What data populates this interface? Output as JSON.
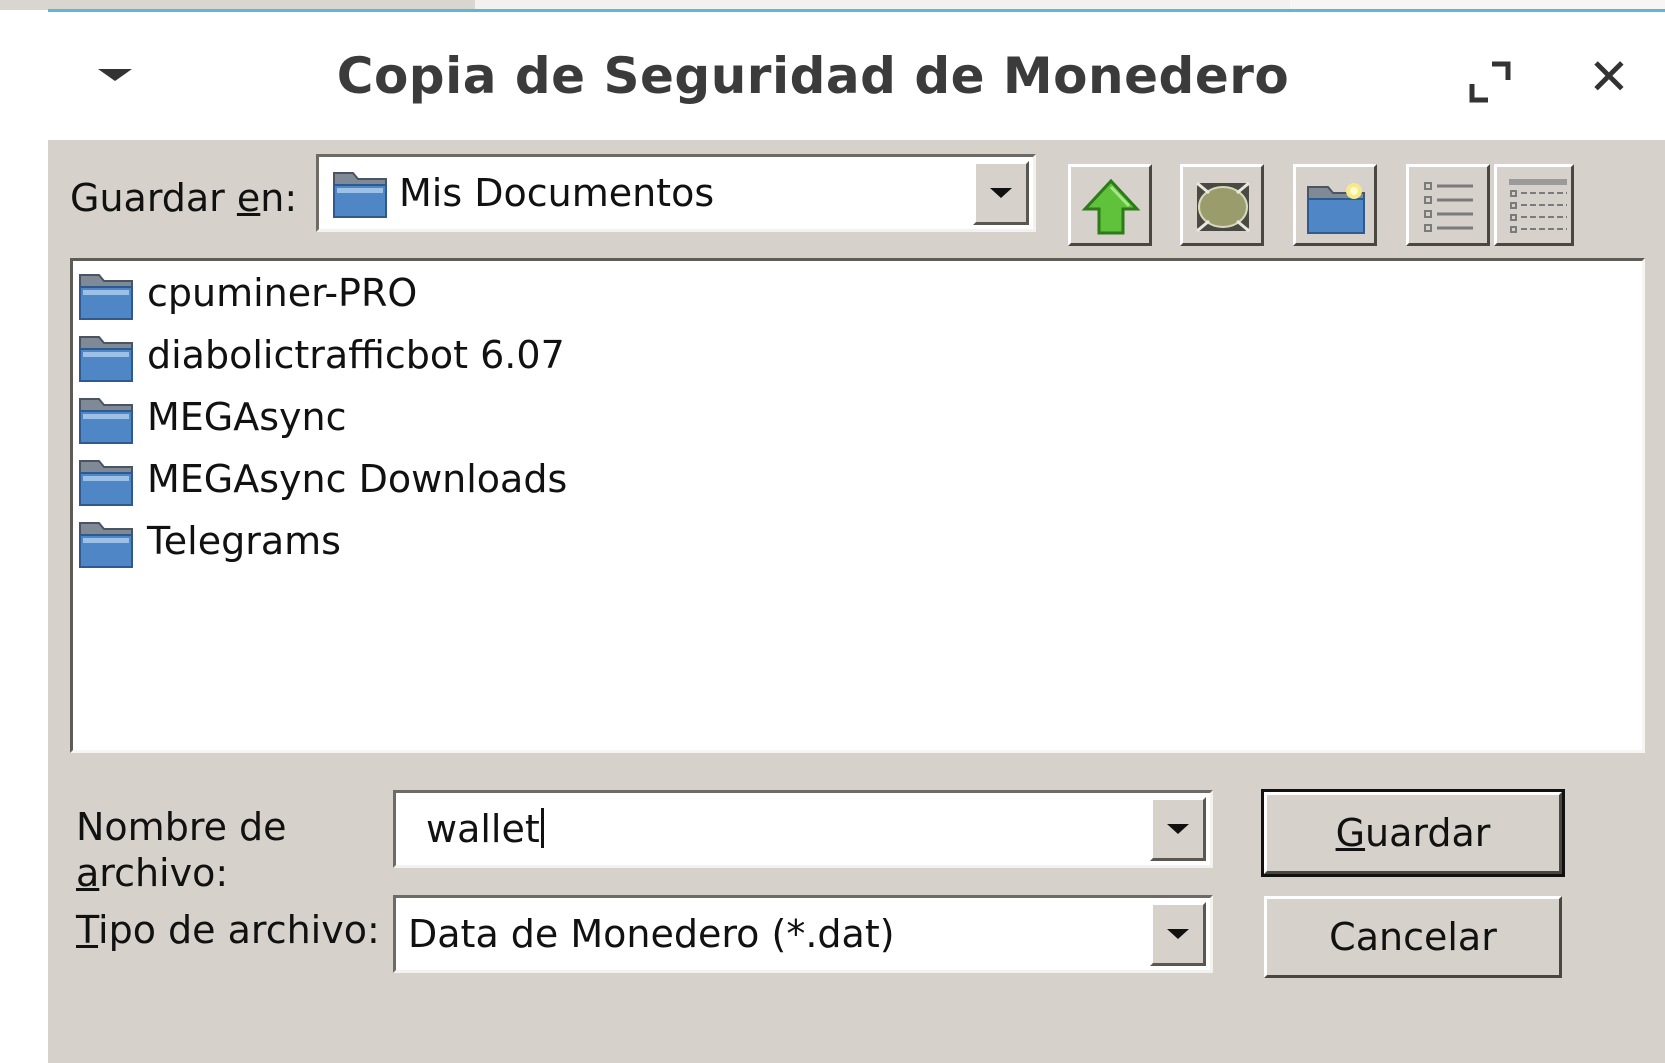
{
  "window": {
    "title": "Copia de Seguridad de Monedero",
    "maximize_icon": "maximize-icon",
    "close_icon": "close-icon",
    "close_glyph": "✕"
  },
  "toolbar": {
    "save_in_label_pre": "Guardar ",
    "save_in_label_mnemonic": "e",
    "save_in_label_post": "n:",
    "location_value": "Mis Documentos",
    "icons": [
      "up-folder-icon",
      "home-icon",
      "new-folder-icon",
      "list-view-icon",
      "details-view-icon"
    ]
  },
  "files": [
    {
      "name": "cpuminer-PRO",
      "icon": "folder-icon"
    },
    {
      "name": "diabolictrafficbot 6.07",
      "icon": "folder-icon"
    },
    {
      "name": "MEGAsync",
      "icon": "folder-icon"
    },
    {
      "name": "MEGAsync Downloads",
      "icon": "folder-icon"
    },
    {
      "name": "Telegrams",
      "icon": "folder-icon"
    }
  ],
  "filename": {
    "label_line1": "Nombre de",
    "label_line2_mnemonic": "a",
    "label_line2_rest": "rchivo:",
    "value": "wallet"
  },
  "filetype": {
    "label_mnemonic": "T",
    "label_rest": "ipo de archivo:",
    "value": "Data de Monedero (*.dat)"
  },
  "buttons": {
    "save_mnemonic": "G",
    "save_rest": "uardar",
    "cancel": "Cancelar"
  },
  "colors": {
    "dialog_bg": "#d6d2cb",
    "accent_line": "#5db8d8",
    "folder_blue": "#4f86c6"
  }
}
